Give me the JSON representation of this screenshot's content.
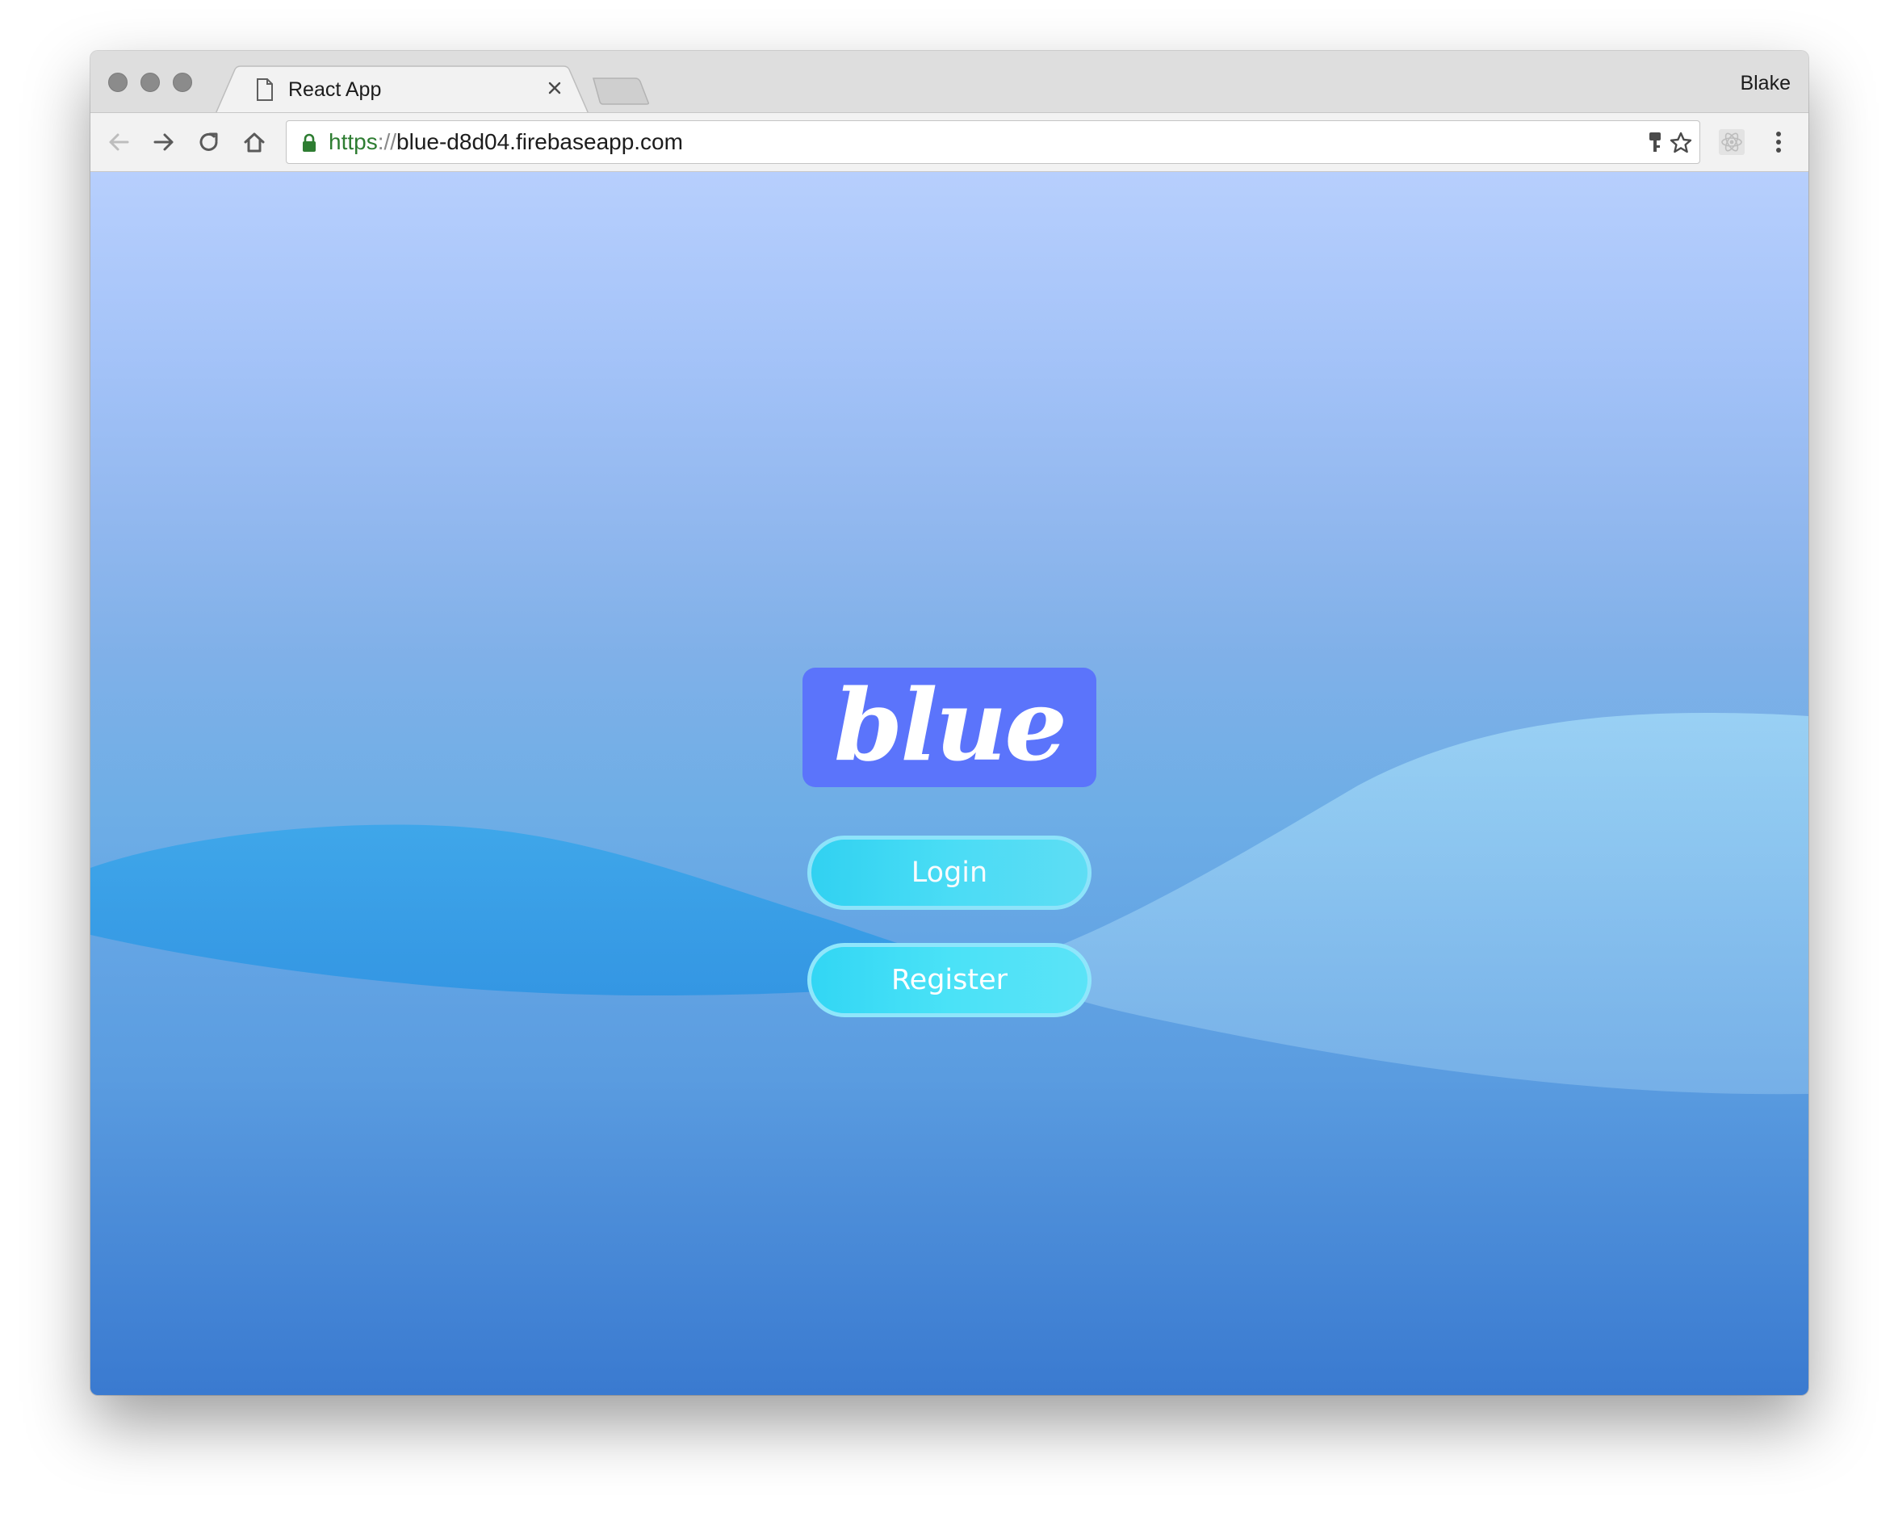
{
  "browser": {
    "tab_title": "React App",
    "profile_name": "Blake",
    "url_scheme": "https",
    "url_separator": "://",
    "url_host": "blue-d8d04.firebaseapp.com",
    "icons": {
      "traffic_lights": [
        "close-window-icon",
        "minimize-window-icon",
        "zoom-window-icon"
      ],
      "tab_page": "page-icon",
      "tab_close": "close-icon",
      "back": "arrow-left-icon",
      "forward": "arrow-right-icon",
      "reload": "reload-icon",
      "home": "home-icon",
      "secure": "lock-icon",
      "password": "key-icon",
      "bookmark": "star-icon",
      "extension": "react-devtools-icon",
      "menu": "kebab-menu-icon"
    }
  },
  "app": {
    "logo_text": "blue",
    "login_label": "Login",
    "register_label": "Register"
  },
  "colors": {
    "logo_background": "#5b74fb",
    "button_fill": "#3fdaf5",
    "button_border": "#8fe6fb",
    "background_top": "#b7cffd",
    "background_bottom": "#3a7ad0",
    "secure_scheme": "#2e7d32"
  }
}
